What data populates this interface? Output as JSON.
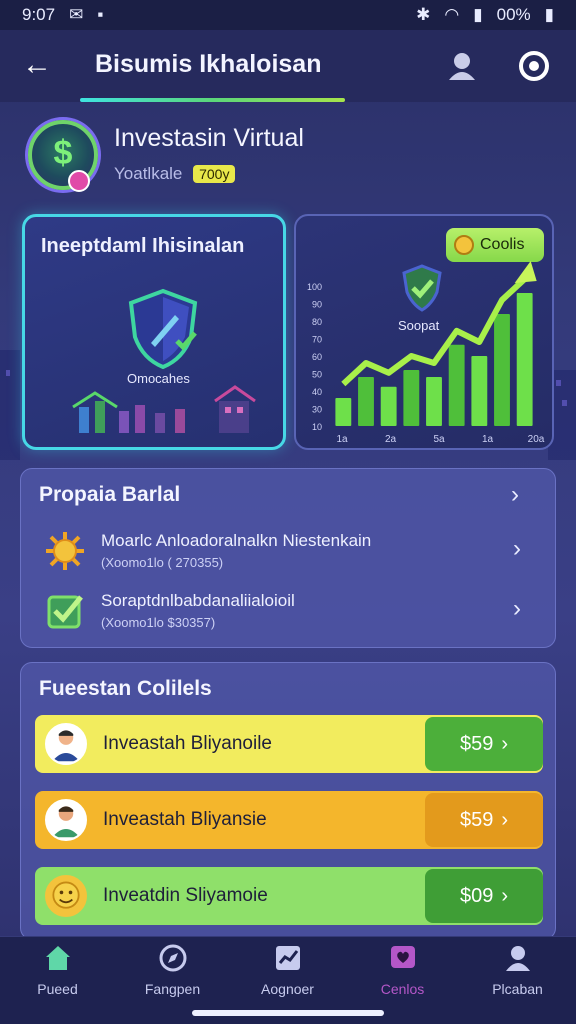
{
  "status_bar": {
    "time": "9:07",
    "battery": "00%"
  },
  "app_bar": {
    "title": "Bisumis Ikhaloisan"
  },
  "profile": {
    "name": "Investasin Virtual",
    "subtitle": "Yoatlkale",
    "badge": "700y"
  },
  "card_left": {
    "title": "Ineeptdaml Ihisinalan",
    "caption": "Omocahes"
  },
  "card_right": {
    "coins_label": "Coolis",
    "shield_caption": "Soopat",
    "chart_data": {
      "type": "bar",
      "y_ticks": [
        "10",
        "30",
        "40",
        "50",
        "60",
        "70",
        "80",
        "90",
        "100"
      ],
      "x_ticks": [
        "1a",
        "2a",
        "5a",
        "1a",
        "20a"
      ],
      "values": [
        20,
        35,
        28,
        40,
        35,
        58,
        50,
        80,
        95
      ]
    }
  },
  "properties": {
    "title": "Propaia Barlal",
    "items": [
      {
        "title": "Moarlc Anloadoralnalkn Niestenkain",
        "detail": "(Xoomo1lo ( 270355)"
      },
      {
        "title": "Soraptdnlbabdanaliialoioil",
        "detail": "(Xoomo1lo $30357)"
      }
    ]
  },
  "investments": {
    "title": "Fueestan Colilels",
    "items": [
      {
        "label": "Inveastah Bliyanoile",
        "price": "$59",
        "row_color": "#f2ec5e",
        "price_color": "#4caf3a"
      },
      {
        "label": "Inveastah Bliyansie",
        "price": "$59",
        "row_color": "#f4b62c",
        "price_color": "#e39a1c"
      },
      {
        "label": "Inveatdin Sliyamoie",
        "price": "$09",
        "row_color": "#8fe06a",
        "price_color": "#3f9e36"
      }
    ]
  },
  "bottom_nav": [
    {
      "label": "Pueed",
      "icon": "home-icon",
      "color": "#5fd7a8"
    },
    {
      "label": "Fangpen",
      "icon": "compass-icon",
      "color": "#c7cbee"
    },
    {
      "label": "Aognoer",
      "icon": "chart-card-icon",
      "color": "#c7cbee"
    },
    {
      "label": "Cenlos",
      "icon": "heart-chat-icon",
      "color": "#b457c8"
    },
    {
      "label": "Plcaban",
      "icon": "person-icon",
      "color": "#c7cbee"
    }
  ]
}
